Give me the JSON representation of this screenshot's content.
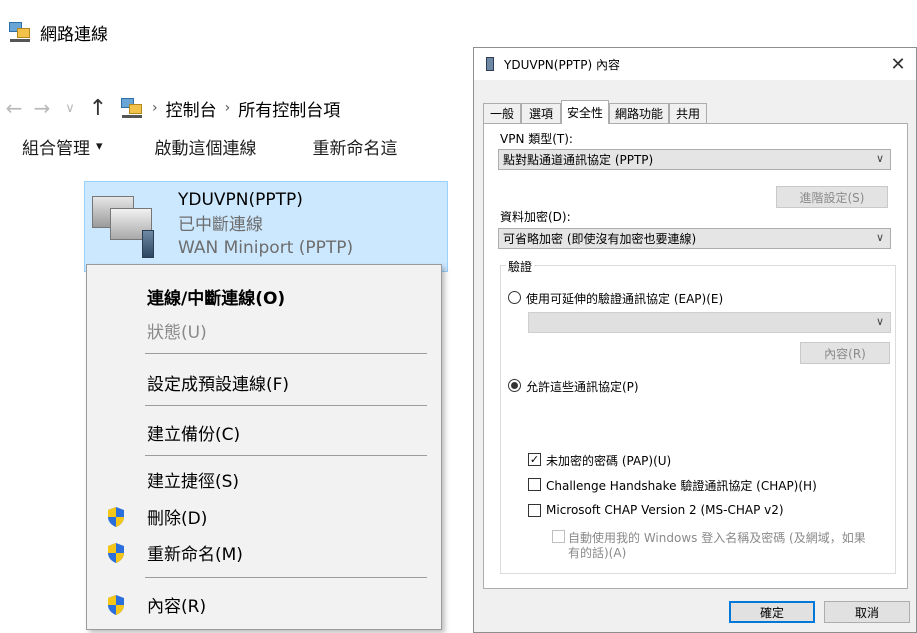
{
  "explorer": {
    "window_title": "網路連線",
    "nav": {
      "back_icon": "←",
      "forward_icon": "→",
      "recent_icon": "∨",
      "up_icon": "↑",
      "breadcrumb": [
        "控制台",
        "所有控制台項"
      ],
      "separator": "›"
    },
    "command_bar": {
      "organize": "組合管理",
      "organize_caret": "▾",
      "start": "啟動這個連線",
      "rename": "重新命名這"
    },
    "connection": {
      "name": "YDUVPN(PPTP)",
      "status": "已中斷連線",
      "device": "WAN Miniport (PPTP)"
    }
  },
  "context_menu": {
    "items": [
      {
        "label": "連線/中斷連線(O)"
      },
      {
        "label": "狀態(U)"
      },
      {
        "label": "設定成預設連線(F)"
      },
      {
        "label": "建立備份(C)"
      },
      {
        "label": "建立捷徑(S)"
      },
      {
        "label": "刪除(D)"
      },
      {
        "label": "重新命名(M)"
      },
      {
        "label": "內容(R)"
      }
    ]
  },
  "dialog": {
    "title": "YDUVPN(PPTP) 內容",
    "close_icon": "✕",
    "tabs": [
      "一般",
      "選項",
      "安全性",
      "網路功能",
      "共用"
    ],
    "vpn_type_label": "VPN 類型(T):",
    "vpn_type_value": "點對點通道通訊協定 (PPTP)",
    "advanced_button": "進階設定(S)",
    "encryption_label": "資料加密(D):",
    "encryption_value": "可省略加密 (即使沒有加密也要連線)",
    "auth_group_label": "驗證",
    "eap_radio": "使用可延伸的驗證通訊協定 (EAP)(E)",
    "properties_button": "內容(R)",
    "allow_radio": "允許這些通訊協定(P)",
    "pap": "未加密的密碼 (PAP)(U)",
    "chap": "Challenge Handshake 驗證通訊協定 (CHAP)(H)",
    "mschap": "Microsoft CHAP Version 2 (MS-CHAP v2)",
    "auto_windows_line1": "自動使用我的 Windows 登入名稱及密碼 (及網域，如果",
    "auto_windows_line2": "有的話)(A)",
    "ok_button": "確定",
    "cancel_button": "取消",
    "checkmark": "✓",
    "combo_arrow": "∨",
    "pap_checked": true,
    "chap_checked": false,
    "mschap_checked": false,
    "auto_windows_checked": false,
    "eap_selected": false,
    "allow_selected": true
  },
  "colors": {
    "selection_bg": "#cce8ff",
    "selection_border": "#99d1ff",
    "accent": "#0078d7",
    "shield_blue": "#2a6fdb",
    "shield_yellow": "#f5c518"
  }
}
